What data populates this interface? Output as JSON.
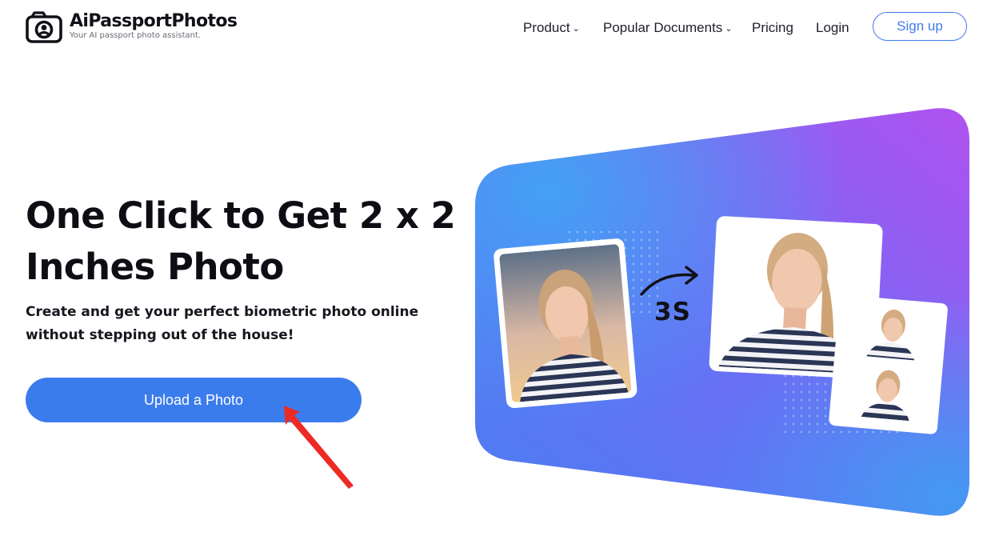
{
  "header": {
    "brand_name": "AiPassportPhotos",
    "tagline": "Your AI passport photo assistant.",
    "nav": [
      {
        "label": "Product",
        "has_dropdown": true
      },
      {
        "label": "Popular Documents",
        "has_dropdown": true
      },
      {
        "label": "Pricing",
        "has_dropdown": false
      },
      {
        "label": "Login",
        "has_dropdown": false
      }
    ],
    "signup_label": "Sign up"
  },
  "hero": {
    "title": "One Click to Get 2 x 2 Inches Photo",
    "subtitle": "Create and get your perfect biometric photo online without stepping out of the house!",
    "upload_label": "Upload a Photo"
  },
  "illustration": {
    "time_label": "3S",
    "icons": [
      "camera-logo-icon",
      "chevron-down-icon",
      "curved-arrow-icon",
      "red-pointer-arrow-icon"
    ]
  },
  "colors": {
    "accent": "#3b7cec",
    "text": "#0d0d14",
    "gradient_start": "#3f86f2",
    "gradient_end": "#a455f2",
    "annotation": "#ee2a24"
  }
}
